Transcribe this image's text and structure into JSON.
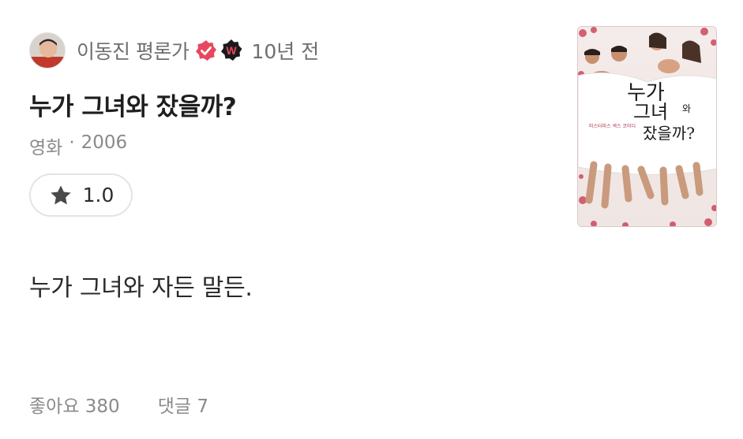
{
  "author": {
    "name": "이동진 평론가",
    "time_ago": "10년 전",
    "avatar": "avatar-photo",
    "badges": [
      "verified-icon",
      "w-badge-icon"
    ]
  },
  "review": {
    "title": "누가 그녀와 잤을까?",
    "category": "영화",
    "separator": "·",
    "year": "2006",
    "rating": "1.0",
    "comment": "누가 그녀와 자든 말든."
  },
  "footer": {
    "likes": "좋아요 380",
    "comments": "댓글 7"
  },
  "poster": {
    "title_lines": [
      "누가",
      "그녀",
      "와",
      "잤을까?"
    ],
    "tagline": "마스터피스 섹스 코미디"
  },
  "colors": {
    "verified": "#e8485f",
    "w_badge_bg": "#1a1a1a",
    "w_badge_text": "#e8485f",
    "star": "#4a4a4a"
  }
}
